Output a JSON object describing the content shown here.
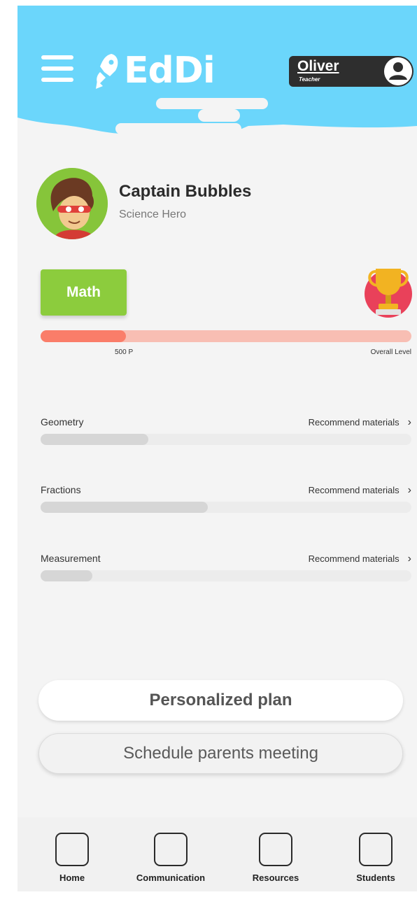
{
  "header": {
    "app_name": "EdDi",
    "user": {
      "name": "Oliver",
      "role": "Teacher"
    },
    "colors": {
      "header_bg": "#6bd6fb"
    }
  },
  "profile": {
    "name": "Captain Bubbles",
    "title": "Science Hero"
  },
  "subject": {
    "label": "Math",
    "color": "#8ccc3d",
    "progress_points": "500 P",
    "progress_label": "Overall Level",
    "progress_fraction": 0.23,
    "progress_color": "#fa7d69"
  },
  "topics": [
    {
      "name": "Geometry",
      "link": "Recommend materials",
      "progress": 0.29
    },
    {
      "name": "Fractions",
      "link": "Recommend materials",
      "progress": 0.45
    },
    {
      "name": "Measurement",
      "link": "Recommend materials",
      "progress": 0.14
    }
  ],
  "actions": {
    "primary": "Personalized plan",
    "secondary": "Schedule parents meeting"
  },
  "nav": [
    {
      "label": "Home"
    },
    {
      "label": "Communication"
    },
    {
      "label": "Resources"
    },
    {
      "label": "Students"
    }
  ],
  "icons": [
    "menu-icon",
    "rocket-logo-icon",
    "user-avatar-icon",
    "trophy-icon",
    "chevron-right-icon",
    "home-icon",
    "communication-icon",
    "resources-icon",
    "students-icon"
  ]
}
